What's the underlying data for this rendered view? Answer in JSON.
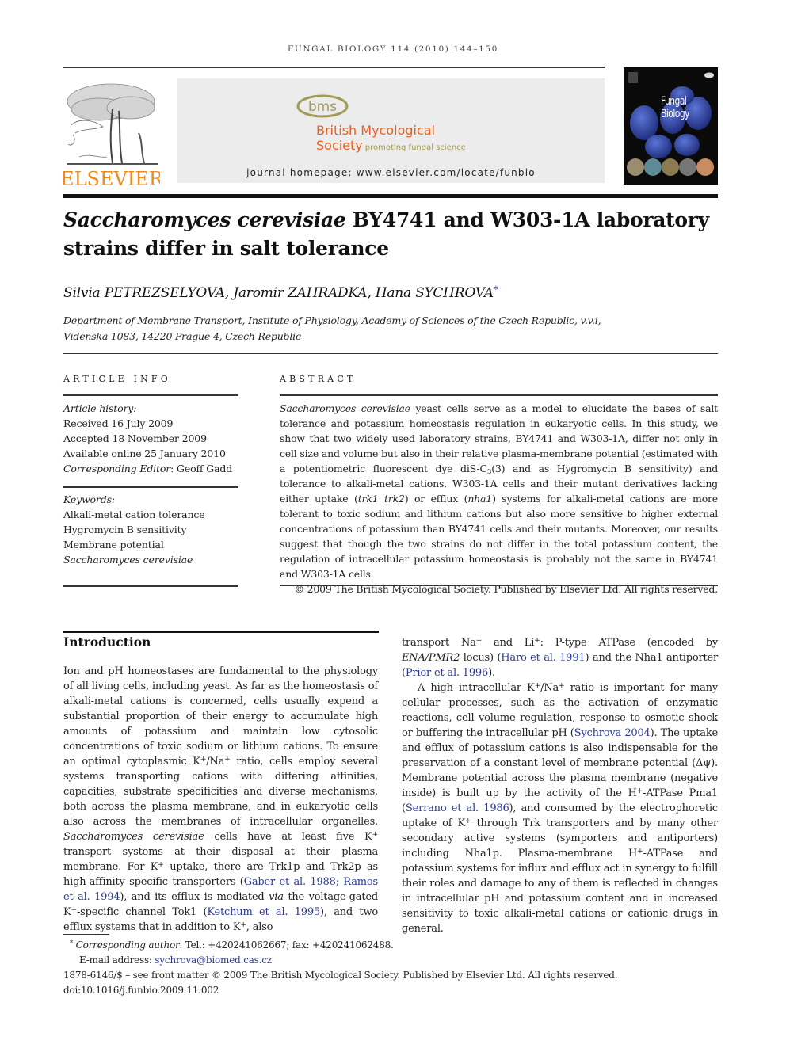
{
  "running_head": "FUNGAL BIOLOGY 114 (2010) 144–150",
  "masthead": {
    "publisher_logo_text": "ELSEVIER",
    "society_logo_text": "bms",
    "society_name_line1": "British Mycological",
    "society_name_line2": "Society",
    "society_tagline": "promoting fungal science",
    "journal_homepage": "journal homepage: www.elsevier.com/locate/funbio",
    "cover_title_line1": "Fungal",
    "cover_title_line2": "Biology",
    "colors": {
      "elsevier_orange": "#f08a1c",
      "bms_orange": "#e8601c",
      "bms_olive": "#a39a55",
      "cover_blue": "#2a3f9e"
    }
  },
  "article": {
    "title_italic": "Saccharomyces cerevisiae",
    "title_rest_line1": " BY4741 and W303-1A laboratory",
    "title_line2": "strains differ in salt tolerance",
    "authors": "Silvia PETREZSELYOVA, Jaromir ZAHRADKA, Hana SYCHROVA",
    "author_mark": "*",
    "affiliation_line1": "Department of Membrane Transport, Institute of Physiology, Academy of Sciences of the Czech Republic, v.v.i,",
    "affiliation_line2": "Videnska 1083, 14220 Prague 4, Czech Republic"
  },
  "article_info": {
    "label": "ARTICLE INFO",
    "history_label": "Article history:",
    "received": "Received 16 July 2009",
    "accepted": "Accepted 18 November 2009",
    "available": "Available online 25 January 2010",
    "editor_label": "Corresponding Editor",
    "editor_name": ": Geoff Gadd",
    "keywords_label": "Keywords:",
    "keywords": [
      "Alkali-metal cation tolerance",
      "Hygromycin B sensitivity",
      "Membrane potential",
      "Saccharomyces cerevisiae"
    ]
  },
  "abstract": {
    "label": "ABSTRACT",
    "p_species": "Saccharomyces cerevisiae",
    "p1": " yeast cells serve as a model to elucidate the bases of salt tolerance and potassium homeostasis regulation in eukaryotic cells. In this study, we show that two widely used laboratory strains, BY4741 and W303-1A, differ not only in cell size and volume but also in their relative plasma-membrane potential (estimated with a potentiometric fluorescent dye diS-C",
    "p1_sub": "3",
    "p2": "(3) and as Hygromycin B sensitivity) and tolerance to alkali-metal cations. W303-1A cells and their mutant derivatives lacking either uptake (",
    "gene_trk": "trk1 trk2",
    "p3": ") or efflux (",
    "gene_nha": "nha1",
    "p4": ") systems for alkali-metal cations are more tolerant to toxic sodium and lithium cations but also more sensitive to higher external concentrations of potassium than BY4741 cells and their mutants. Moreover, our results suggest that though the two strains do not differ in the total potassium content, the regulation of intracellular potassium homeostasis is probably not the same in BY4741 and W303-1A cells.",
    "copyright": "© 2009 The British Mycological Society. Published by Elsevier Ltd. All rights reserved."
  },
  "introduction": {
    "heading": "Introduction",
    "left": {
      "a": "Ion and pH homeostases are fundamental to the physiology of all living cells, including yeast. As far as the homeostasis of alkali-metal cations is concerned, cells usually expend a substantial proportion of their energy to accumulate high amounts of potassium and maintain low cytosolic concentrations of toxic sodium or lithium cations. To ensure an optimal cytoplasmic K",
      "b": "/Na",
      "c": " ratio, cells employ several systems transporting cations with differing affinities, capacities, substrate specificities and diverse mechanisms, both across the plasma membrane, and in eukaryotic cells also across the membranes of intracellular organelles. ",
      "species": "Saccharomyces cerevisiae",
      "d": " cells have at least five K",
      "e": " transport systems at their disposal at their plasma membrane. For K",
      "f": " uptake, there are Trk1p and Trk2p as high-affinity specific transporters (",
      "ref1": "Gaber et al. 1988",
      "sep": "; ",
      "ref2": "Ramos et al. 1994",
      "g": "), and its efflux is mediated ",
      "via": "via",
      "h": " the voltage-gated K",
      "i": "-specific channel Tok1 (",
      "ref3": "Ketchum et al. 1995",
      "j": "), and two efflux systems that in addition to K",
      "k": ", also"
    },
    "right": {
      "a": "transport Na",
      "b": " and Li",
      "c": ": P-type ATPase (encoded by ",
      "gene": "ENA/PMR2",
      "d": " locus) (",
      "ref1": "Haro et al. 1991",
      "e": ") and the Nha1 antiporter (",
      "ref2": "Prior et al. 1996",
      "f": ").",
      "p2a": "A high intracellular K",
      "p2b": "/Na",
      "p2c": " ratio is important for many cellular processes, such as the activation of enzymatic reactions, cell volume regulation, response to osmotic shock or buffering the intracellular pH (",
      "ref3": "Sychrova 2004",
      "p2d": "). The uptake and efflux of potassium cations is also indispensable for the preservation of a constant level of membrane potential (Δψ). Membrane potential across the plasma membrane (negative inside) is built up by the activity of the H",
      "p2e": "-ATPase Pma1 (",
      "ref4": "Serrano et al. 1986",
      "p2f": "), and consumed by the electrophoretic uptake of K",
      "p2g": " through Trk transporters and by many other secondary active systems (symporters and antiporters) including Nha1p. Plasma-membrane H",
      "p2h": "-ATPase and potassium systems for influx and efflux act in synergy to fulfill their roles and damage to any of them is reflected in changes in intracellular pH and potassium content and in increased sensitivity to toxic alkali-metal cations or cationic drugs in general."
    },
    "plus": "+"
  },
  "footnotes": {
    "mark": "*",
    "corr_label": "Corresponding author",
    "corr_rest": ". Tel.: +420241062667; fax: +420241062488.",
    "email_label": "E-mail address: ",
    "email": "sychrova@biomed.cas.cz",
    "front_matter": "1878-6146/$ – see front matter © 2009 The British Mycological Society. Published by Elsevier Ltd. All rights reserved.",
    "doi": "doi:10.1016/j.funbio.2009.11.002"
  }
}
